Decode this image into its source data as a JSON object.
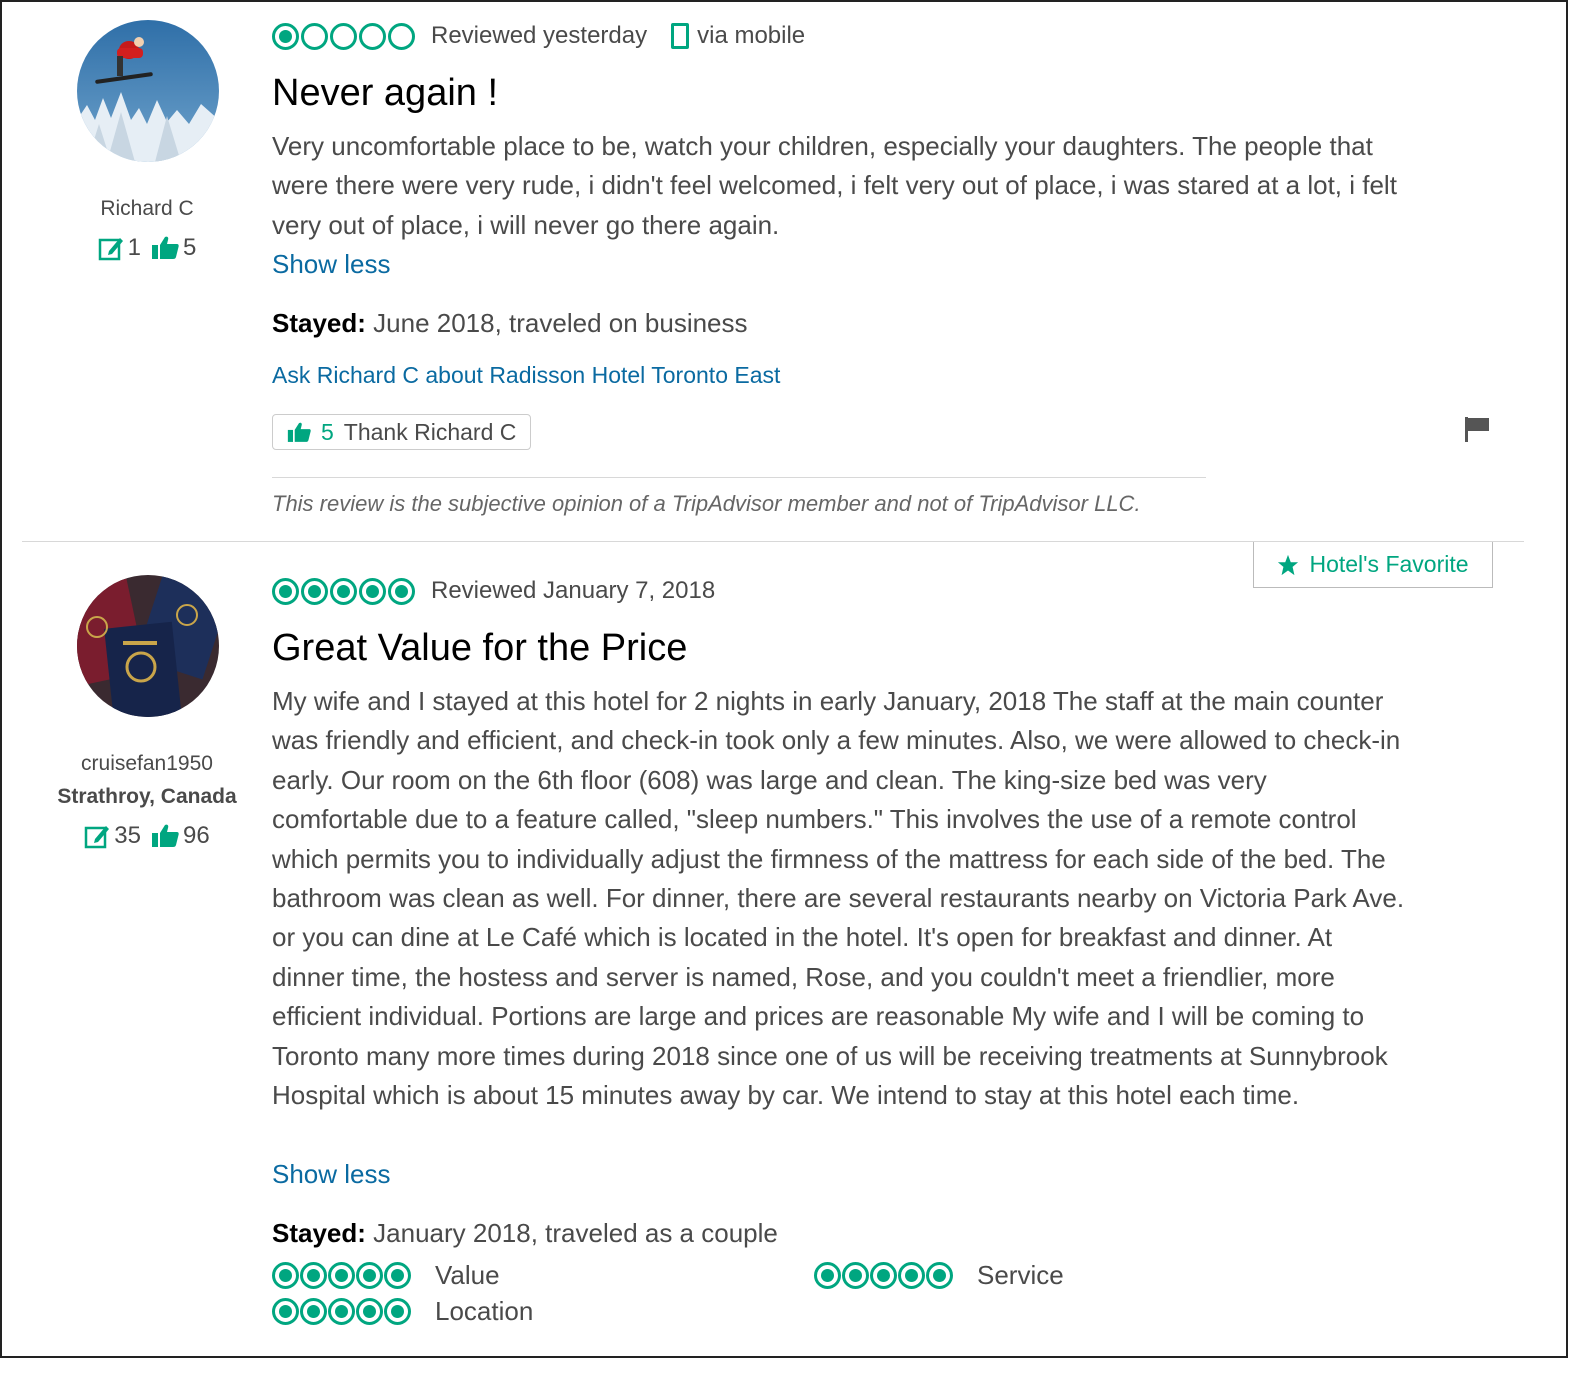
{
  "colors": {
    "accent": "#00a680",
    "link": "#0a6aa1",
    "text": "#4a4a4a",
    "title": "#000000"
  },
  "reviews": [
    {
      "user": {
        "name": "Richard C",
        "location": "",
        "contributions": "1",
        "helpful": "5"
      },
      "rating": 1,
      "date": "Reviewed yesterday",
      "via": "via mobile",
      "title": "Never again !",
      "body": "Very uncomfortable place to be, watch your children, especially your daughters. The people that were there were very rude, i didn't feel welcomed, i felt very out of place, i was stared at a lot, i felt very out of place, i will never go there again.",
      "show_less": "Show less",
      "stayed_label": "Stayed:",
      "stayed_value": " June 2018, traveled on business",
      "ask": "Ask Richard C about Radisson Hotel Toronto East",
      "thank_count": "5",
      "thank_label": "Thank Richard C",
      "disclaimer": "This review is the subjective opinion of a TripAdvisor member and not of TripAdvisor LLC."
    },
    {
      "badge": "Hotel's Favorite",
      "user": {
        "name": "cruisefan1950",
        "location": "Strathroy, Canada",
        "contributions": "35",
        "helpful": "96"
      },
      "rating": 5,
      "date": "Reviewed January 7, 2018",
      "title": "Great Value for the Price",
      "body": "My wife and I stayed at this hotel for 2 nights in early January, 2018 The staff at the main counter was friendly and efficient, and check-in took only a few minutes. Also, we were allowed to check-in early. Our room on the 6th floor (608) was large and clean. The king-size bed was very comfortable due to a feature called, \"sleep numbers.\" This involves the use of a remote control which permits you to individually adjust the firmness of the mattress for each side of the bed. The bathroom was clean as well. For dinner, there are several restaurants nearby on Victoria Park Ave. or you can dine at Le Café which is located in the hotel. It's open for breakfast and dinner. At dinner time, the hostess and server is named, Rose, and you couldn't meet a friendlier, more efficient individual. Portions are large and prices are reasonable My wife and I will be coming to Toronto many more times during 2018 since one of us will be receiving treatments at Sunnybrook Hospital which is about 15 minutes away by car. We intend to stay at this hotel each time.",
      "show_less": "Show less",
      "stayed_label": "Stayed:",
      "stayed_value": " January 2018, traveled as a couple",
      "subratings": [
        {
          "label": "Value",
          "rating": 5
        },
        {
          "label": "Service",
          "rating": 5
        },
        {
          "label": "Location",
          "rating": 5
        }
      ]
    }
  ]
}
